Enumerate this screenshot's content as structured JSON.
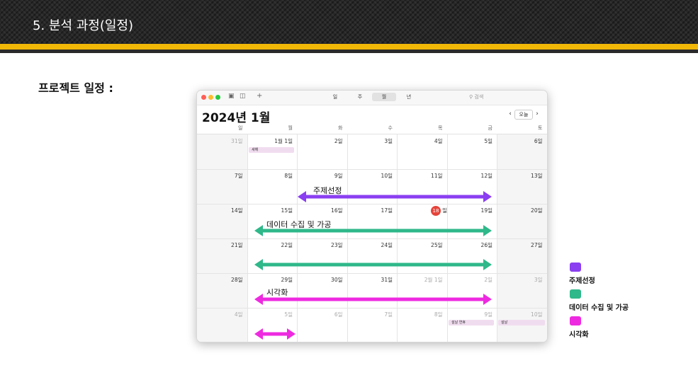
{
  "slide": {
    "section_title": "5. 분석 과정(일정)",
    "heading": "프로젝트 일정 :"
  },
  "toolbar": {
    "tabs": [
      "일",
      "주",
      "월",
      "년"
    ],
    "selected_tab": "월",
    "search_placeholder": "검색",
    "icons": [
      "calendar-icon",
      "inbox-icon",
      "plus-icon",
      "magnifier-icon"
    ]
  },
  "calendar": {
    "month_title": "2024년 1월",
    "today_label": "오늘",
    "prev": "‹",
    "next": "›",
    "weekdays": [
      "일",
      "월",
      "화",
      "수",
      "목",
      "금",
      "토"
    ],
    "today_number": "18",
    "today_suffix": "일",
    "weeks": [
      [
        "31일",
        "1월 1일",
        "2일",
        "3일",
        "4일",
        "5일",
        "6일"
      ],
      [
        "7일",
        "8일",
        "9일",
        "10일",
        "11일",
        "12일",
        "13일"
      ],
      [
        "14일",
        "15일",
        "16일",
        "17일",
        "",
        "19일",
        "20일"
      ],
      [
        "21일",
        "22일",
        "23일",
        "24일",
        "25일",
        "26일",
        "27일"
      ],
      [
        "28일",
        "29일",
        "30일",
        "31일",
        "2월 1일",
        "2일",
        "3일"
      ],
      [
        "4일",
        "5일",
        "6일",
        "7일",
        "8일",
        "9일",
        "10일"
      ]
    ],
    "events": {
      "new_year": "새해",
      "seollal_holiday": "설날 연휴",
      "seollal": "설날"
    }
  },
  "bars": {
    "topic": "주제선정",
    "data": "데이터 수집 및 가공",
    "viz": "시각화"
  },
  "legend": [
    {
      "label": "주제선정",
      "color": "#8a3ff0"
    },
    {
      "label": "데이터 수집 및 가공",
      "color": "#2fb88a"
    },
    {
      "label": "시각화",
      "color": "#ee2ae0"
    }
  ],
  "colors": {
    "topic": "#8a3ff0",
    "data": "#2fb88a",
    "viz": "#ee2ae0",
    "accent_yellow": "#f2b807",
    "today_red": "#e5443b"
  }
}
